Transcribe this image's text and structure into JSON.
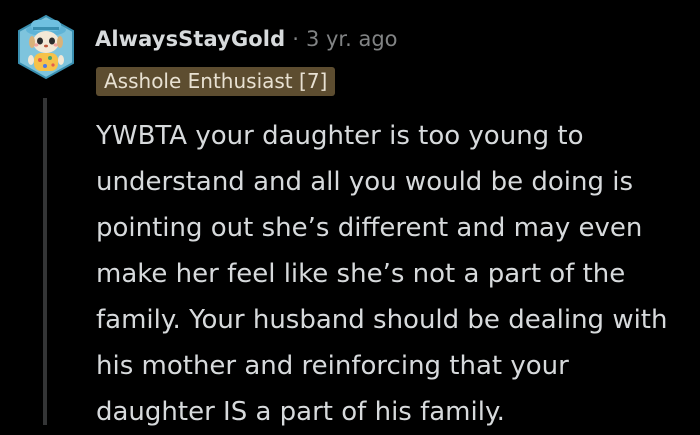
{
  "comment": {
    "username": "AlwaysStayGold",
    "separator": "·",
    "timestamp": "3 yr. ago",
    "flair": "Asshole Enthusiast [7]",
    "avatar_icon": "snoo-avatar-icon",
    "body_lines": [
      "YWBTA your daughter is too young to",
      "understand and all you would be doing is",
      "pointing out she’s different and may even",
      "make her feel like she’s not a part of the",
      "family. Your husband should be dealing with",
      "his mother and reinforcing that your",
      "daughter IS a part of his family."
    ]
  },
  "colors": {
    "background": "#000000",
    "text": "#d7dadc",
    "muted": "#818384",
    "flair_bg": "#5d4d30",
    "thread_line": "#343536"
  }
}
